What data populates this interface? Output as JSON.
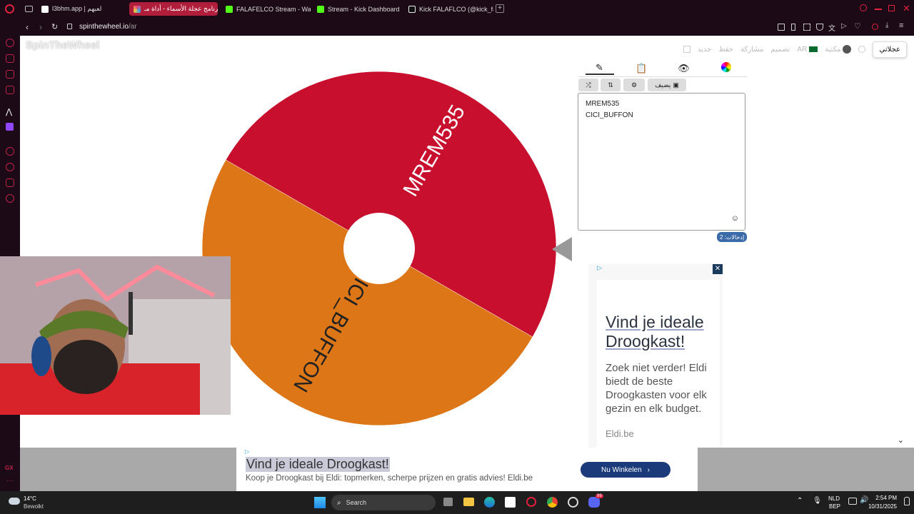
{
  "browser": {
    "tabs": [
      {
        "label": "l3bhm.app | لعبهم",
        "active": false,
        "favicon_color": "#ffffff"
      },
      {
        "label": "برنامج عجلة الأسماء - أداة مـ",
        "active": true,
        "favicon_color": "#e4407a"
      },
      {
        "label": "FALAFELCO Stream - Wa",
        "active": false,
        "favicon_color": "#53fc18"
      },
      {
        "label": "Stream - Kick Dashboard",
        "active": false,
        "favicon_color": "#53fc18"
      },
      {
        "label": "Kick FALAFLCO (@kick_fa",
        "active": false,
        "favicon_color": "#ffffff"
      }
    ],
    "url_domain": "spinthewheel.io",
    "url_path": "/ar",
    "accent": "#c0224b"
  },
  "site": {
    "logo": "SpinTheWheel",
    "top_menu": [
      "جديد",
      "حفظ",
      "مشاركة",
      "تصميم",
      "AR",
      "مكتبة"
    ],
    "quick_label": "عجلاتي",
    "panel_tabs": [
      "pencil-icon",
      "clipboard-icon",
      "eye-off-icon",
      "add-color-icon"
    ],
    "add_image_label": "يضيف",
    "entries": [
      "MREM535",
      "CICI_BUFFON"
    ],
    "entry_count_label": "إدخالات: 2"
  },
  "wheel": {
    "segments": [
      {
        "label": "MREM535",
        "color": "#c8102e"
      },
      {
        "label": "CICI_BUFFON",
        "color": "#dc7617"
      }
    ]
  },
  "ad_side": {
    "title": "Vind je ideale Droogkast!",
    "body": "Zoek niet verder! Eldi biedt de beste Droogkasten voor elk gezin en elk budget.",
    "domain": "Eldi.be"
  },
  "ad_bottom": {
    "title": "Vind je ideale Droogkast!",
    "body": "Koop je Droogkast bij Eldi: topmerken, scherpe prijzen en gratis advies! Eldi.be",
    "cta": "Nu Winkelen",
    "cta_color": "#1b3a7a"
  },
  "taskbar": {
    "temp": "14°C",
    "weather": "Bewolkt",
    "search": "Search",
    "lang": "NLD",
    "lang2": "BEP",
    "time": "2:54 PM",
    "date": "10/31/2025",
    "badge": "99"
  }
}
